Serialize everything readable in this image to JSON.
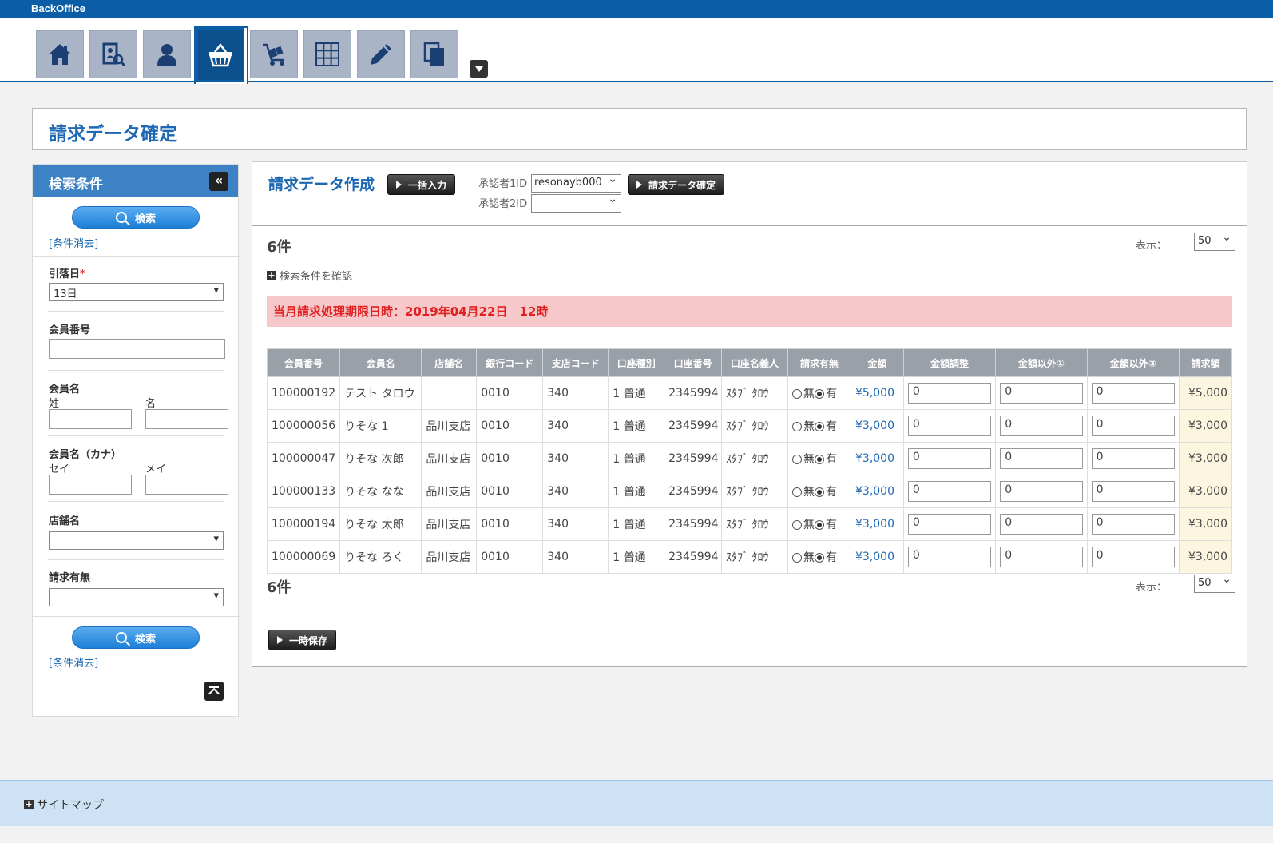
{
  "app": {
    "title": "BackOffice"
  },
  "nav": {
    "items": [
      {
        "name": "home-icon"
      },
      {
        "name": "member-search-icon"
      },
      {
        "name": "user-icon"
      },
      {
        "name": "basket-icon"
      },
      {
        "name": "cart-icon"
      },
      {
        "name": "grid-icon"
      },
      {
        "name": "pencil-icon"
      },
      {
        "name": "documents-icon"
      }
    ]
  },
  "page": {
    "title": "請求データ確定"
  },
  "sidebar": {
    "header": "検索条件",
    "search_label": "検索",
    "clear_label": "[条件消去]",
    "withdraw_day": {
      "label": "引落日",
      "required": "*",
      "value": "13日"
    },
    "member_no": {
      "label": "会員番号"
    },
    "member_name": {
      "label": "会員名",
      "last": "姓",
      "first": "名"
    },
    "member_kana": {
      "label": "会員名（カナ）",
      "last": "セイ",
      "first": "メイ"
    },
    "store_name": {
      "label": "店舗名",
      "value": ""
    },
    "billing_flag": {
      "label": "請求有無",
      "value": ""
    }
  },
  "main": {
    "title": "請求データ作成",
    "bulk_input_label": "一括入力",
    "confirm_label": "請求データ確定",
    "approver1": {
      "label": "承認者1ID",
      "value": "resonayb000"
    },
    "approver2": {
      "label": "承認者2ID",
      "value": ""
    },
    "count": "6件",
    "display_label": "表示：",
    "display_value": "50",
    "confirm_conditions": "検索条件を確認",
    "deadline": "当月請求処理期限日時：2019年04月22日　12時",
    "save_label": "一時保存",
    "columns": [
      "会員番号",
      "会員名",
      "店舗名",
      "銀行コード",
      "支店コード",
      "口座種別",
      "口座番号",
      "口座名義人",
      "請求有無",
      "金額",
      "金額調整",
      "金額以外①",
      "金額以外②",
      "請求額"
    ],
    "radio_no": "無",
    "radio_yes": "有",
    "rows": [
      {
        "no": "100000192",
        "name": "テスト タロウ",
        "store": "",
        "bank": "0010",
        "branch": "340",
        "type": "1 普通",
        "acct": "2345994",
        "holder": "ｽﾀﾌﾞ ﾀﾛｳ",
        "amount": "¥5,000",
        "adj": "0",
        "other1": "0",
        "other2": "0",
        "total": "¥5,000"
      },
      {
        "no": "100000056",
        "name": "りそな 1",
        "store": "品川支店",
        "bank": "0010",
        "branch": "340",
        "type": "1 普通",
        "acct": "2345994",
        "holder": "ｽﾀﾌﾞ ﾀﾛｳ",
        "amount": "¥3,000",
        "adj": "0",
        "other1": "0",
        "other2": "0",
        "total": "¥3,000"
      },
      {
        "no": "100000047",
        "name": "りそな 次郎",
        "store": "品川支店",
        "bank": "0010",
        "branch": "340",
        "type": "1 普通",
        "acct": "2345994",
        "holder": "ｽﾀﾌﾞ ﾀﾛｳ",
        "amount": "¥3,000",
        "adj": "0",
        "other1": "0",
        "other2": "0",
        "total": "¥3,000"
      },
      {
        "no": "100000133",
        "name": "りそな なな",
        "store": "品川支店",
        "bank": "0010",
        "branch": "340",
        "type": "1 普通",
        "acct": "2345994",
        "holder": "ｽﾀﾌﾞ ﾀﾛｳ",
        "amount": "¥3,000",
        "adj": "0",
        "other1": "0",
        "other2": "0",
        "total": "¥3,000"
      },
      {
        "no": "100000194",
        "name": "りそな 太郎",
        "store": "品川支店",
        "bank": "0010",
        "branch": "340",
        "type": "1 普通",
        "acct": "2345994",
        "holder": "ｽﾀﾌﾞ ﾀﾛｳ",
        "amount": "¥3,000",
        "adj": "0",
        "other1": "0",
        "other2": "0",
        "total": "¥3,000"
      },
      {
        "no": "100000069",
        "name": "りそな ろく",
        "store": "品川支店",
        "bank": "0010",
        "branch": "340",
        "type": "1 普通",
        "acct": "2345994",
        "holder": "ｽﾀﾌﾞ ﾀﾛｳ",
        "amount": "¥3,000",
        "adj": "0",
        "other1": "0",
        "other2": "0",
        "total": "¥3,000"
      }
    ]
  },
  "footer": {
    "sitemap": "サイトマップ"
  }
}
